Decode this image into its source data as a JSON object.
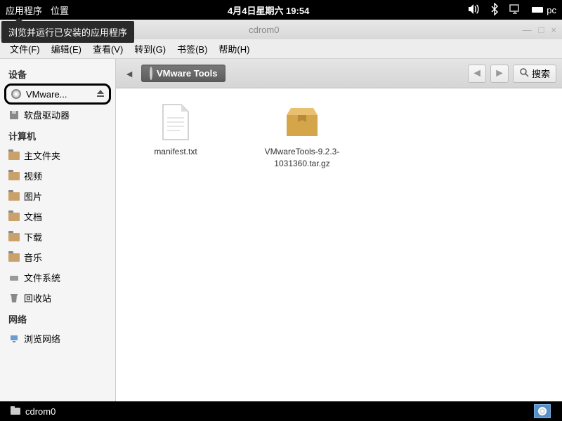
{
  "top_panel": {
    "apps": "应用程序",
    "places": "位置",
    "datetime": "4月4日星期六 19:54",
    "user_label": "pc"
  },
  "tooltip": "浏览并运行已安装的应用程序",
  "window": {
    "title": "cdrom0"
  },
  "menubar": {
    "file": "文件(F)",
    "edit": "编辑(E)",
    "view": "查看(V)",
    "go": "转到(G)",
    "bookmarks": "书签(B)",
    "help": "帮助(H)"
  },
  "sidebar": {
    "devices_header": "设备",
    "devices": [
      {
        "label": "VMware...",
        "icon": "disc",
        "highlighted": true,
        "ejectable": true
      },
      {
        "label": "软盘驱动器",
        "icon": "floppy"
      }
    ],
    "computer_header": "计算机",
    "computer": [
      {
        "label": "主文件夹",
        "icon": "home"
      },
      {
        "label": "视频",
        "icon": "folder"
      },
      {
        "label": "图片",
        "icon": "folder"
      },
      {
        "label": "文档",
        "icon": "folder"
      },
      {
        "label": "下载",
        "icon": "folder"
      },
      {
        "label": "音乐",
        "icon": "folder"
      },
      {
        "label": "文件系统",
        "icon": "drive"
      },
      {
        "label": "回收站",
        "icon": "trash"
      }
    ],
    "network_header": "网络",
    "network": [
      {
        "label": "浏览网络",
        "icon": "network"
      }
    ]
  },
  "toolbar": {
    "breadcrumb": "VMware Tools",
    "search_label": "搜索"
  },
  "files": [
    {
      "name": "manifest.txt",
      "type": "text"
    },
    {
      "name": "VMwareTools-9.2.3-1031360.tar.gz",
      "type": "archive"
    }
  ],
  "taskbar": {
    "item": "cdrom0"
  }
}
